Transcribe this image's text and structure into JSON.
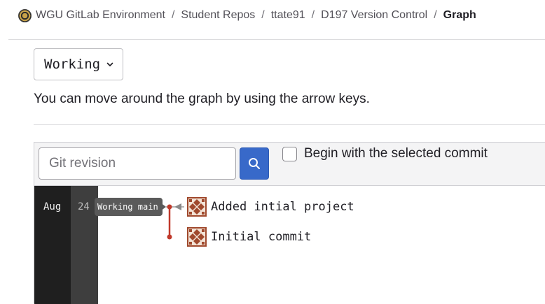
{
  "breadcrumb": {
    "items": [
      {
        "label": "WGU GitLab Environment"
      },
      {
        "label": "Student Repos"
      },
      {
        "label": "ttate91"
      },
      {
        "label": "D197 Version Control"
      },
      {
        "label": "Graph"
      }
    ],
    "separator": "/"
  },
  "ref_selector": {
    "value": "Working"
  },
  "help_text": "You can move around the graph by using the arrow keys.",
  "toolbar": {
    "revision_placeholder": "Git revision",
    "revision_value": "",
    "checkbox_label": "Begin with the selected commit",
    "checkbox_checked": false
  },
  "graph": {
    "month": "Aug",
    "day": "24",
    "ref_label": "Working main",
    "commits": [
      {
        "message": "Added intial project"
      },
      {
        "message": "Initial commit"
      }
    ]
  },
  "colors": {
    "accent": "#3869c9",
    "graph_line": "#c0392b",
    "avatar": "#a0492d"
  }
}
